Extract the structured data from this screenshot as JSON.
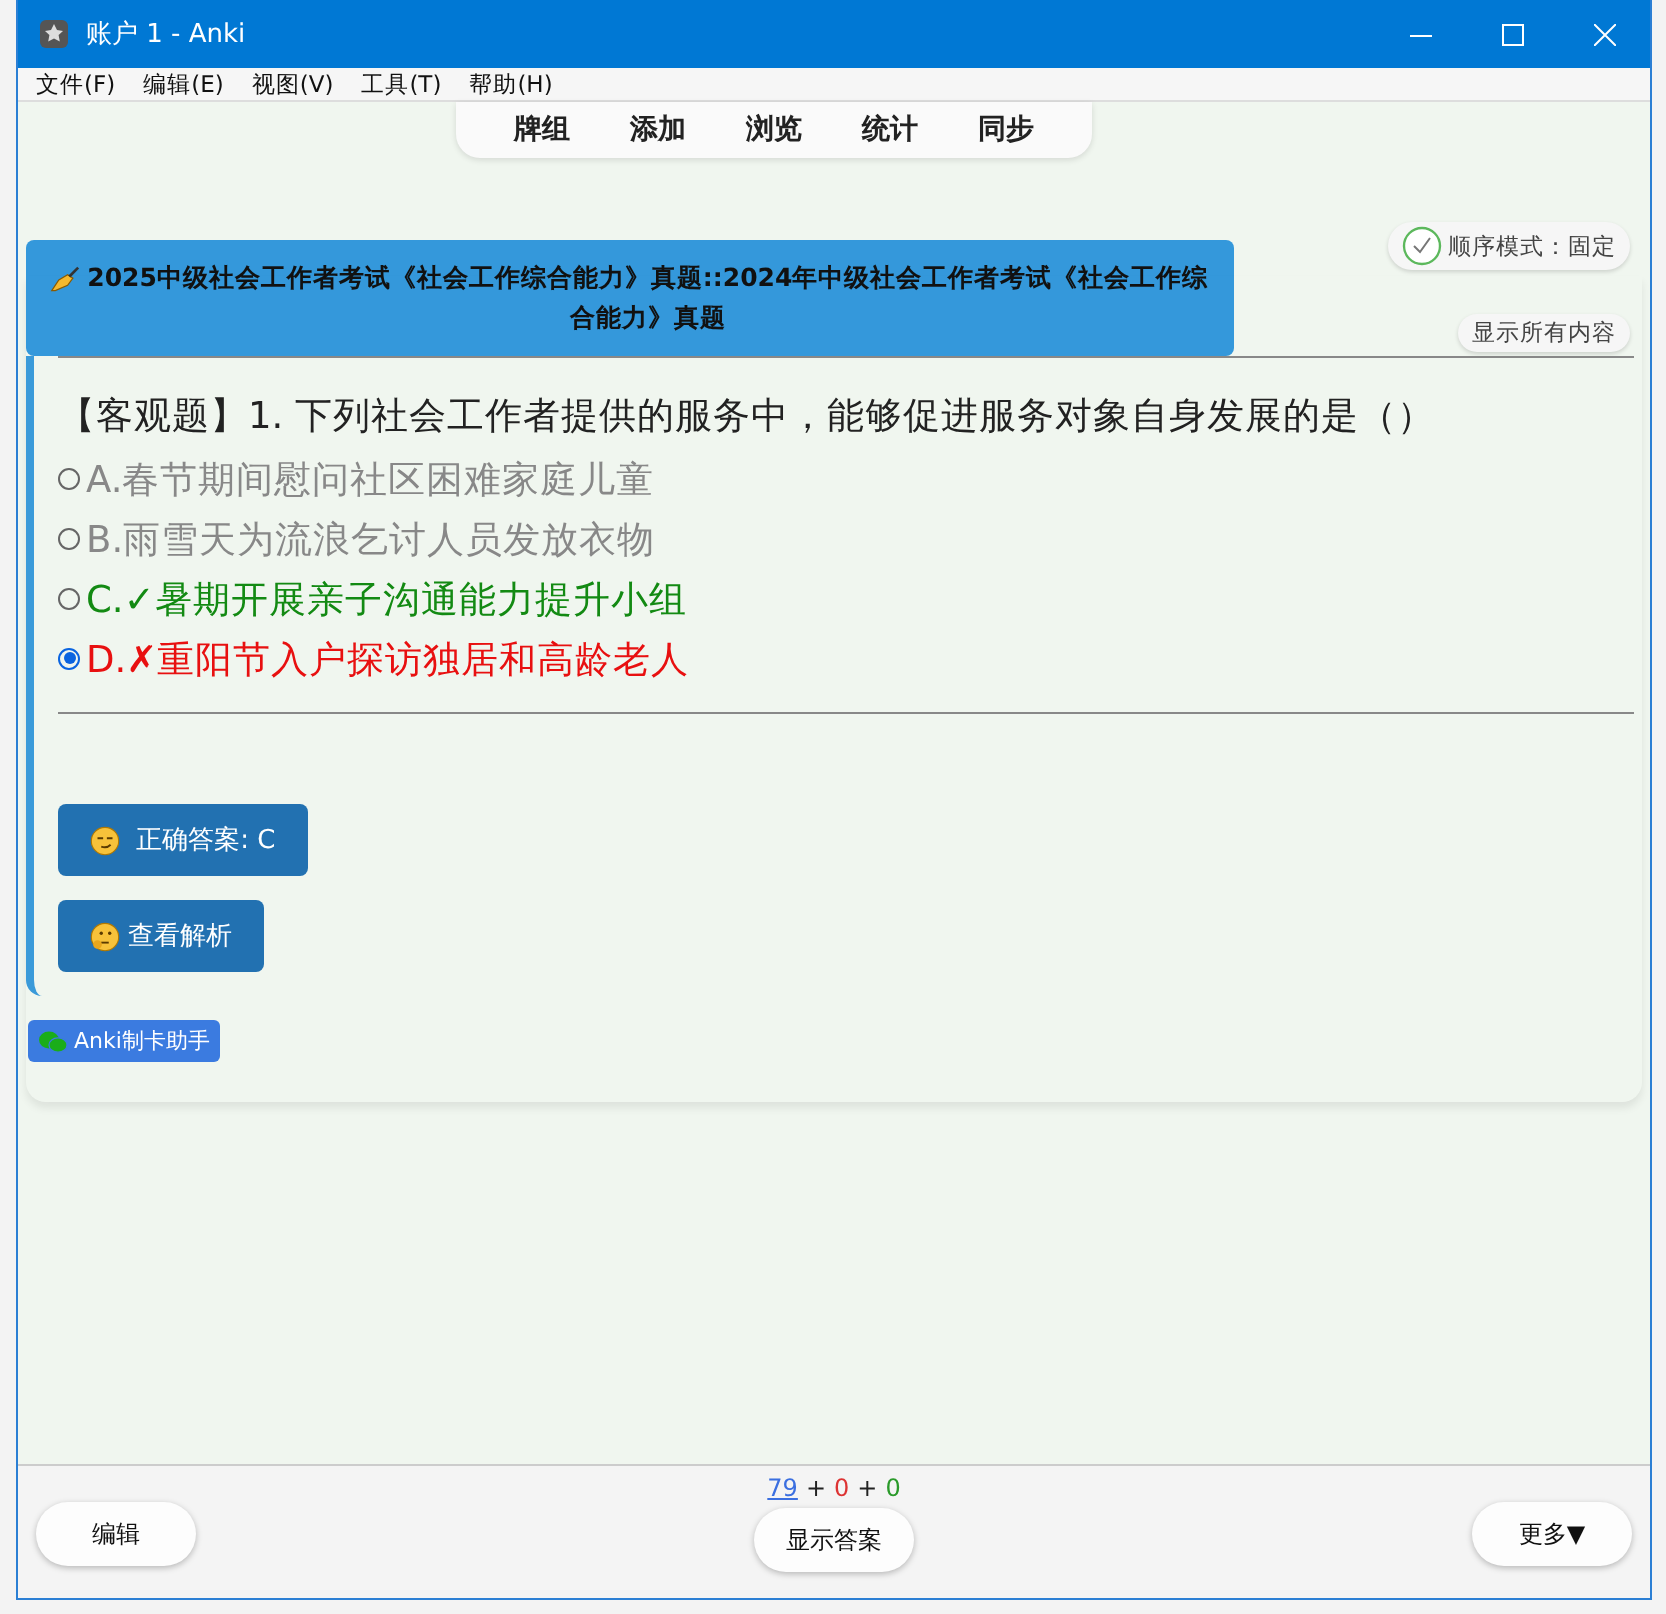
{
  "window": {
    "title": "账户 1 - Anki"
  },
  "menu": [
    "文件(F)",
    "编辑(E)",
    "视图(V)",
    "工具(T)",
    "帮助(H)"
  ],
  "toolbar": [
    "牌组",
    "添加",
    "浏览",
    "统计",
    "同步"
  ],
  "order_mode": {
    "label": "顺序模式：固定"
  },
  "show_all_button": "显示所有内容",
  "deck_title": "2025中级社会工作者考试《社会工作综合能力》真题::2024年中级社会工作者考试《社会工作综合能力》真题",
  "question": "【客观题】1. 下列社会工作者提供的服务中，能够促进服务对象自身发展的是（）",
  "options": [
    {
      "letter": "A.",
      "text": "春节期间慰问社区困难家庭儿童",
      "kind": "neutral",
      "selected": false
    },
    {
      "letter": "B.",
      "text": "雨雪天为流浪乞讨人员发放衣物",
      "kind": "neutral",
      "selected": false
    },
    {
      "letter": "C.",
      "mark": "✓",
      "text": "暑期开展亲子沟通能力提升小组",
      "kind": "correct",
      "selected": false
    },
    {
      "letter": "D.",
      "mark": "✗",
      "text": "重阳节入户探访独居和高龄老人",
      "kind": "wrong",
      "selected": true
    }
  ],
  "answer_button": "正确答案: C",
  "analysis_button": "查看解析",
  "tag": "Anki制卡助手",
  "counts": [
    {
      "text": "79",
      "kind": "new"
    },
    {
      "text": "+",
      "kind": "sep"
    },
    {
      "text": "0",
      "kind": "learn"
    },
    {
      "text": "+",
      "kind": "sep"
    },
    {
      "text": "0",
      "kind": "review"
    }
  ],
  "bottom": {
    "edit": "编辑",
    "show_answer": "显示答案",
    "more": "更多▼"
  }
}
